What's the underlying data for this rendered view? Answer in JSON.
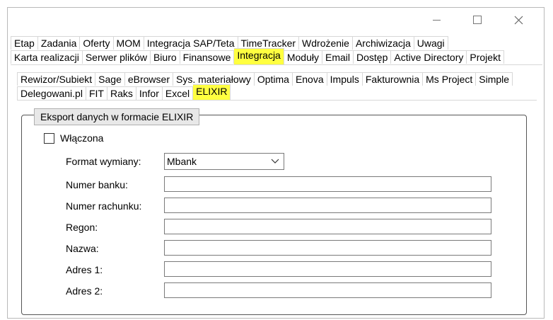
{
  "tabs_row1": [
    "Etap",
    "Zadania",
    "Oferty",
    "MOM",
    "Integracja SAP/Teta",
    "TimeTracker",
    "Wdrożenie",
    "Archiwizacja",
    "Uwagi"
  ],
  "tabs_row2": [
    "Karta realizacji",
    "Serwer plików",
    "Biuro",
    "Finansowe",
    "Integracja",
    "Moduły",
    "Email",
    "Dostęp",
    "Active Directory",
    "Projekt"
  ],
  "subtabs_row1": [
    "Rewizor/Subiekt",
    "Sage",
    "eBrowser",
    "Sys. materiałowy",
    "Optima",
    "Enova",
    "Impuls",
    "Fakturownia",
    "Ms Project",
    "Simple"
  ],
  "subtabs_row2": [
    "Delegowani.pl",
    "FIT",
    "Raks",
    "Infor",
    "Excel",
    "ELIXIR"
  ],
  "highlight_color": "#ffff40",
  "group": {
    "title": "Eksport danych w formacie ELIXIR",
    "enabled_label": "Włączona"
  },
  "form": {
    "format_label": "Format wymiany:",
    "format_value": "Mbank",
    "fields": [
      {
        "label": "Numer banku:",
        "value": ""
      },
      {
        "label": "Numer rachunku:",
        "value": ""
      },
      {
        "label": "Regon:",
        "value": ""
      },
      {
        "label": "Nazwa:",
        "value": ""
      },
      {
        "label": "Adres 1:",
        "value": ""
      },
      {
        "label": "Adres 2:",
        "value": ""
      }
    ]
  }
}
